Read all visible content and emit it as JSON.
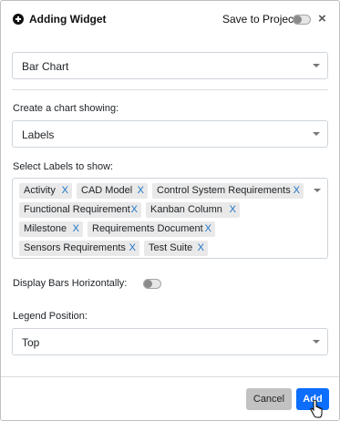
{
  "header": {
    "title": "Adding Widget",
    "save_label": "Save to Project",
    "icons": {
      "add": "plus-circle-icon",
      "close": "close-icon"
    },
    "close_glyph": "×"
  },
  "widget_type": {
    "value": "Bar Chart"
  },
  "chart_showing": {
    "label": "Create a chart showing:",
    "value": "Labels"
  },
  "labels_select": {
    "label": "Select Labels to show:",
    "remove_glyph": "X",
    "tags": [
      "Activity",
      "CAD Model",
      "Control System Requirements",
      "Functional Requirement",
      "Kanban Column",
      "Milestone",
      "Requirements Document",
      "Sensors Requirements",
      "Test Suite"
    ]
  },
  "display_horizontal": {
    "label": "Display Bars Horizontally:"
  },
  "legend_position": {
    "label": "Legend Position:",
    "value": "Top"
  },
  "footer": {
    "cancel_label": "Cancel",
    "add_label": "Add"
  },
  "colors": {
    "accent": "#0d6efd",
    "tag_remove": "#1a73c5",
    "cancel_bg": "#c2c2c2"
  }
}
